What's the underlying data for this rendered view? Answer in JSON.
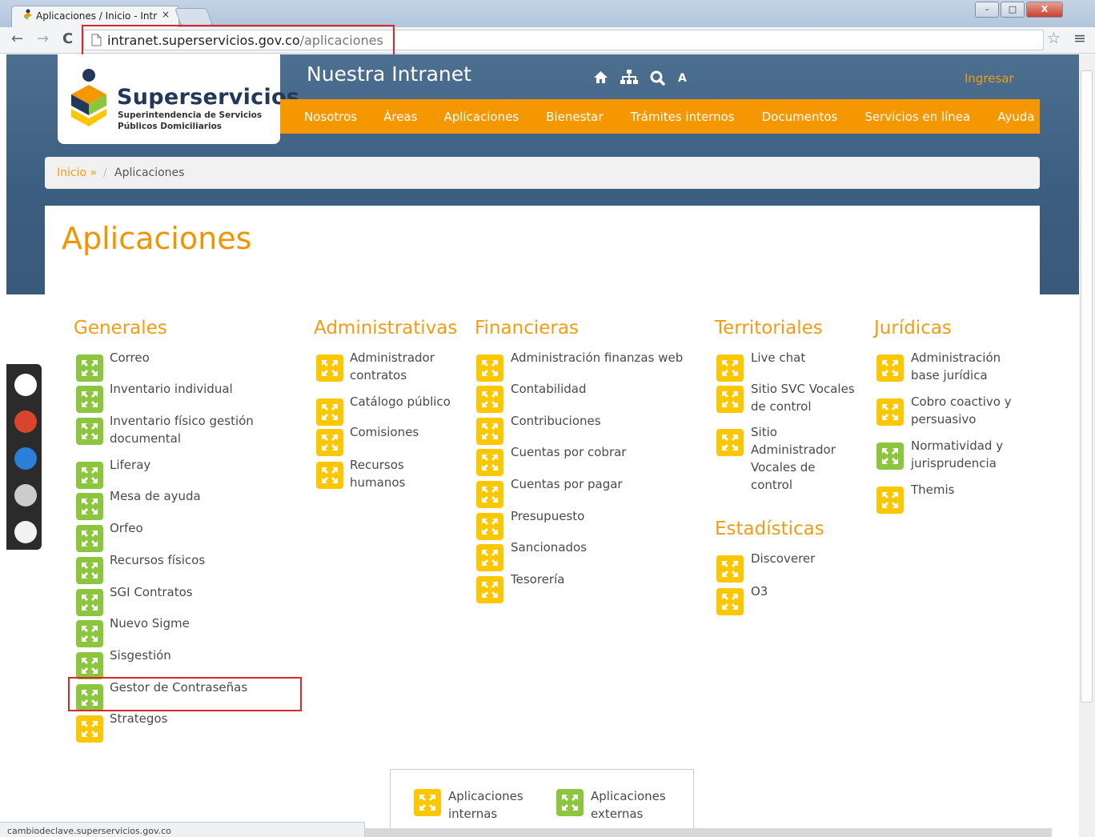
{
  "browser": {
    "tab_title": "Aplicaciones / Inicio - Intr",
    "tab_close": "×",
    "url_host": "intranet.superservicios.gov.co",
    "url_path": "/aplicaciones",
    "back": "←",
    "forward": "→",
    "reload": "C",
    "star": "☆",
    "menu": "≡",
    "win_min": "–",
    "win_max": "□",
    "win_close": "X"
  },
  "header": {
    "brand": "Superservicios",
    "brand_sub1": "Superintendencia de Servicios",
    "brand_sub2": "Públicos Domiciliarios",
    "title": "Nuestra Intranet",
    "font_size_toggle": "A",
    "login": "Ingresar"
  },
  "nav": {
    "items": [
      "Nosotros",
      "Áreas",
      "Aplicaciones",
      "Bienestar",
      "Trámites internos",
      "Documentos",
      "Servicios en línea",
      "Ayuda"
    ]
  },
  "breadcrumb": {
    "home": "Inicio »",
    "sep": "/",
    "current": "Aplicaciones"
  },
  "page_title": "Aplicaciones",
  "columns": {
    "generales": {
      "title": "Generales",
      "items": [
        "Correo",
        "Inventario individual",
        "Inventario físico gestión documental",
        "Liferay",
        "Mesa de ayuda",
        "Orfeo",
        "Recursos físicos",
        "SGI Contratos",
        "Nuevo Sigme",
        "Sisgestión",
        "Gestor de Contraseñas",
        "Strategos"
      ]
    },
    "administrativas": {
      "title": "Administrativas",
      "items": [
        "Administrador contratos",
        "Catálogo público",
        "Comisiones",
        "Recursos humanos"
      ]
    },
    "financieras": {
      "title": "Financieras",
      "items": [
        "Administración finanzas web",
        "Contabilidad",
        "Contribuciones",
        "Cuentas por cobrar",
        "Cuentas por pagar",
        "Presupuesto",
        "Sancionados",
        "Tesorería"
      ]
    },
    "territoriales": {
      "title": "Territoriales",
      "items": [
        "Live chat",
        "Sitio SVC Vocales de control",
        "Sitio Administrador Vocales de control"
      ]
    },
    "estadisticas": {
      "title": "Estadísticas",
      "items": [
        "Discoverer",
        "O3"
      ]
    },
    "juridicas": {
      "title": "Jurídicas",
      "items": [
        "Administración base jurídica",
        "Cobro coactivo y persuasivo",
        "Normatividad y jurisprudencia",
        "Themis"
      ]
    }
  },
  "legend": {
    "internal": "Aplicaciones internas",
    "external": "Aplicaciones externas"
  },
  "status_bar": "cambiodeclave.superservicios.gov.co",
  "colors": {
    "orange": "#f49700",
    "internal_icon": "#8cc63f",
    "external_icon": "#fdc700",
    "hero": "#3f6183",
    "highlight": "#d42a2a"
  }
}
